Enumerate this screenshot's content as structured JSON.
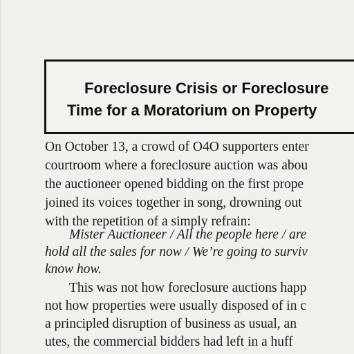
{
  "title": {
    "line1": "Foreclosure Crisis or Foreclosure",
    "line2": "Time for a Moratorium on Property"
  },
  "body_lines": [
    "On October 13, a crowd of O4O supporters enter",
    "courtroom where a foreclosure auction was abou",
    "the auctioneer opened bidding on the first prope",
    "joined its voices together in song, drowning out",
    "with the repetition of a simply refrain:",
    "Mister Auctioneer / All the people here / are",
    "hold all the sales for now / We’re going to surviv",
    "know how.",
    "This was not how foreclosure auctions happ",
    "not how properties were usually disposed of in c",
    "a principled disruption of business as usual, an",
    "utes, the commercial bidders had left in a huff"
  ]
}
